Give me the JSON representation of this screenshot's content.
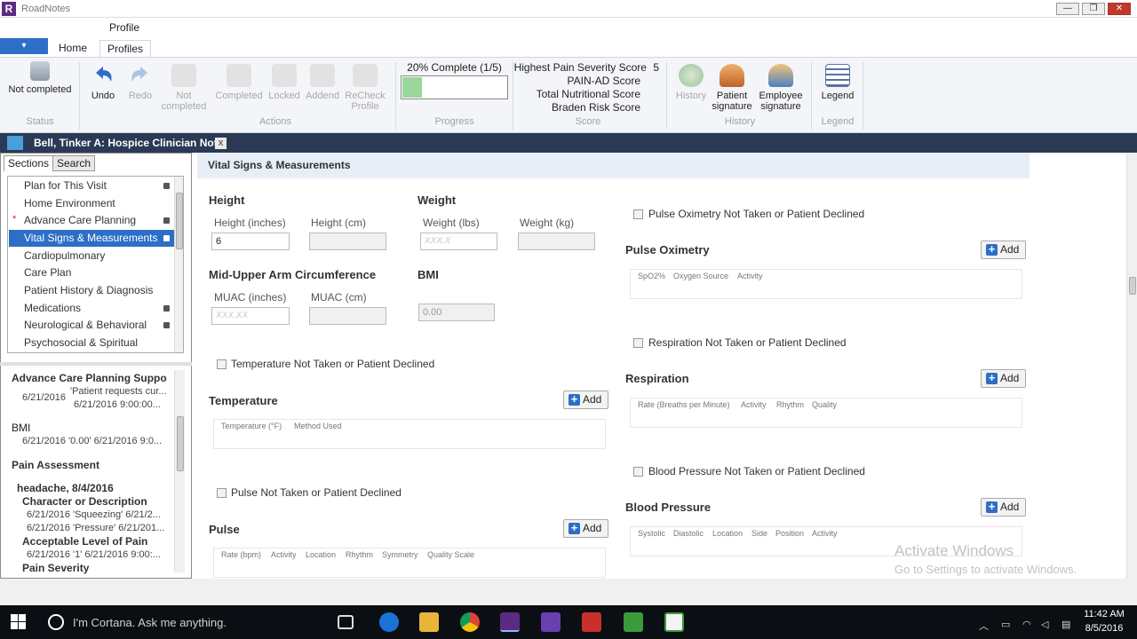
{
  "window": {
    "title": "RoadNotes",
    "app_logo": "R",
    "minimize": "—",
    "restore": "❐",
    "close": "✕"
  },
  "ribbon": {
    "context_group": "Profile",
    "file_menu": "▾",
    "tabs": [
      {
        "label": "Home"
      },
      {
        "label": "Profiles"
      }
    ],
    "status": {
      "value": "Not completed",
      "group": "Status"
    },
    "actions": {
      "undo": "Undo",
      "redo": "Redo",
      "not_completed_1": "Not",
      "not_completed_2": "completed",
      "completed": "Completed",
      "locked": "Locked",
      "addend": "Addend",
      "recheck_1": "ReCheck",
      "recheck_2": "Profile",
      "group": "Actions"
    },
    "progress": {
      "label": "20% Complete (1/5)",
      "percent": 20,
      "group": "Progress"
    },
    "score": {
      "highest_pain_label": "Highest Pain Severity Score",
      "highest_pain_value": "5",
      "painad": "PAIN-AD Score",
      "nutritional": "Total Nutritional Score",
      "braden": "Braden Risk Score",
      "group": "Score"
    },
    "history": {
      "history": "History",
      "patient_sig_1": "Patient",
      "patient_sig_2": "signature",
      "employee_sig_1": "Employee",
      "employee_sig_2": "signature",
      "group": "History"
    },
    "legend": {
      "label": "Legend",
      "group": "Legend"
    }
  },
  "document_tab": {
    "title": "Bell, Tinker A: Hospice Clinician Note",
    "close": "x"
  },
  "left_panel": {
    "tabs": {
      "sections": "Sections",
      "search": "Search"
    },
    "nav_items": [
      {
        "label": "Plan for This Visit",
        "dot": true,
        "star": false,
        "selected": false
      },
      {
        "label": "Home Environment",
        "dot": false,
        "star": false,
        "selected": false
      },
      {
        "label": "Advance Care Planning",
        "dot": true,
        "star": true,
        "selected": false
      },
      {
        "label": "Vital Signs & Measurements",
        "dot": true,
        "star": false,
        "selected": true
      },
      {
        "label": "Cardiopulmonary",
        "dot": false,
        "star": false,
        "selected": false
      },
      {
        "label": "Care Plan",
        "dot": false,
        "star": false,
        "selected": false
      },
      {
        "label": "Patient History & Diagnosis",
        "dot": false,
        "star": false,
        "selected": false
      },
      {
        "label": "Medications",
        "dot": true,
        "star": false,
        "selected": false
      },
      {
        "label": "Neurological & Behavioral",
        "dot": true,
        "star": false,
        "selected": false
      },
      {
        "label": "Psychosocial & Spiritual",
        "dot": false,
        "star": false,
        "selected": false
      }
    ],
    "summary": {
      "acp_title": "Advance Care Planning Suppor...",
      "acp_date": "6/21/2016",
      "acp_text": "'Patient requests cur...",
      "acp_text2": "6/21/2016 9:00:00...",
      "bmi_title": "BMI",
      "bmi_line": "6/21/2016 '0.00' 6/21/2016 9:0...",
      "pain_title": "Pain Assessment",
      "headache": "headache, 8/4/2016",
      "char_desc": "Character or Description",
      "char_line1": "6/21/2016 'Squeezing' 6/21/2...",
      "char_line2": "6/21/2016 'Pressure' 6/21/201...",
      "acceptable": "Acceptable Level of Pain",
      "acceptable_line": "6/21/2016 '1' 6/21/2016 9:00:...",
      "severity": "Pain Severity"
    }
  },
  "content": {
    "section_title": "Vital Signs & Measurements",
    "height": {
      "heading": "Height",
      "inches_label": "Height (inches)",
      "inches_value": "6",
      "cm_label": "Height (cm)",
      "cm_value": ""
    },
    "weight": {
      "heading": "Weight",
      "lbs_label": "Weight (lbs)",
      "lbs_placeholder": "XXX.X",
      "kg_label": "Weight (kg)",
      "kg_value": ""
    },
    "muac": {
      "heading": "Mid-Upper Arm Circumference",
      "inches_label": "MUAC (inches)",
      "inches_placeholder": "XXX.XX",
      "cm_label": "MUAC (cm)",
      "cm_value": ""
    },
    "bmi": {
      "heading": "BMI",
      "value": "0.00"
    },
    "temperature": {
      "not_taken": "Temperature Not Taken or Patient Declined",
      "heading": "Temperature",
      "add": "Add",
      "columns": [
        "Temperature (°F)",
        "Method Used"
      ]
    },
    "pulse": {
      "not_taken": "Pulse Not Taken or Patient Declined",
      "heading": "Pulse",
      "add": "Add",
      "columns": [
        "Rate (bpm)",
        "Activity",
        "Location",
        "Rhythm",
        "Symmetry",
        "Quality Scale"
      ]
    },
    "pulse_ox": {
      "not_taken": "Pulse Oximetry Not Taken or Patient Declined",
      "heading": "Pulse Oximetry",
      "add": "Add",
      "columns": [
        "SpO2%",
        "Oxygen Source",
        "Activity"
      ]
    },
    "respiration": {
      "not_taken": "Respiration Not Taken or Patient Declined",
      "heading": "Respiration",
      "add": "Add",
      "columns": [
        "Rate (Breaths per Minute)",
        "Activity",
        "Rhythm",
        "Quality"
      ]
    },
    "blood_pressure": {
      "not_taken": "Blood Pressure Not Taken or Patient Declined",
      "heading": "Blood Pressure",
      "add": "Add",
      "columns": [
        "Systolic",
        "Diastolic",
        "Location",
        "Side",
        "Position",
        "Activity"
      ]
    }
  },
  "watermark": {
    "line1": "Activate Windows",
    "line2": "Go to Settings to activate Windows."
  },
  "taskbar": {
    "cortana_placeholder": "I'm Cortana. Ask me anything.",
    "time": "11:42 AM",
    "date": "8/5/2016"
  },
  "colors": {
    "accent": "#2d6ec7",
    "dark_bar": "#2a3a55",
    "taskbar": "#0b0f14",
    "progress_fill": "#9bd69b"
  },
  "icons": [
    "undo-icon",
    "redo-icon",
    "lock-icon",
    "history-icon",
    "signature-icon",
    "legend-icon",
    "home-icon",
    "plus-icon",
    "windows-icon",
    "cortana-icon"
  ]
}
